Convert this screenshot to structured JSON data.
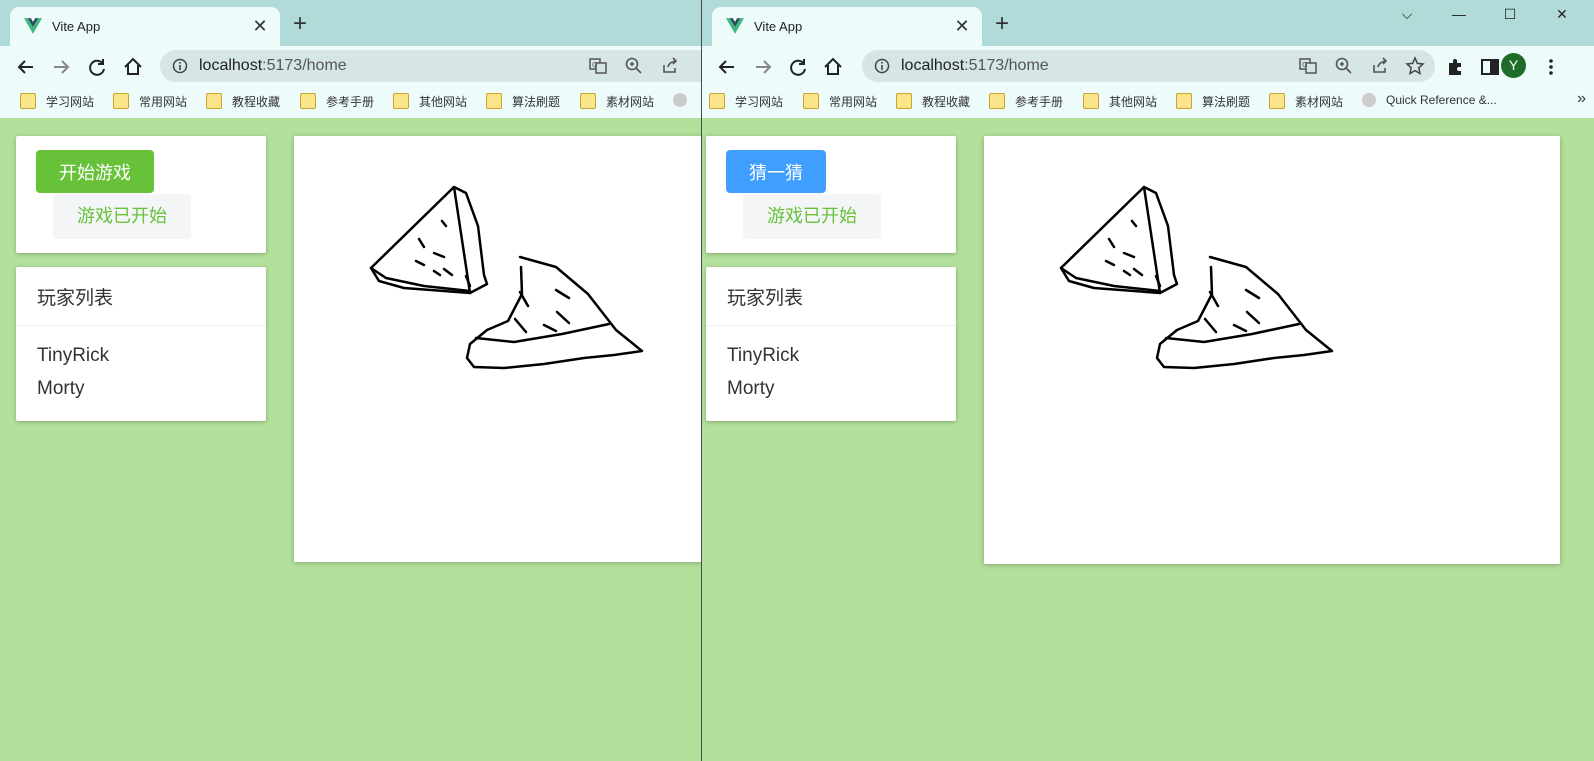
{
  "windows": [
    {
      "tab": {
        "title": "Vite App",
        "favicon": "vue-logo-icon"
      },
      "address": {
        "host": "localhost",
        "path": ":5173/home"
      },
      "bookmarks": [
        "学习网站",
        "常用网站",
        "教程收藏",
        "参考手册",
        "其他网站",
        "算法刷题",
        "素材网站"
      ],
      "game": {
        "action_button": "开始游戏",
        "action_color": "#67c23a",
        "status": "游戏已开始",
        "players_title": "玩家列表",
        "players": [
          "TinyRick",
          "Morty"
        ]
      }
    },
    {
      "tab": {
        "title": "Vite App",
        "favicon": "vue-logo-icon"
      },
      "address": {
        "host": "localhost",
        "path": ":5173/home"
      },
      "bookmarks": [
        "学习网站",
        "常用网站",
        "教程收藏",
        "参考手册",
        "其他网站",
        "算法刷题",
        "素材网站",
        "Quick Reference &..."
      ],
      "profile_initial": "Y",
      "game": {
        "action_button": "猜一猜",
        "action_color": "#409eff",
        "status": "游戏已开始",
        "players_title": "玩家列表",
        "players": [
          "TinyRick",
          "Morty"
        ]
      }
    }
  ],
  "colors": {
    "page_background": "#b3e09b",
    "tab_strip": "#b1dbd8",
    "toolbar": "#eefbfb",
    "status_text": "#67c23a"
  },
  "drawing": {
    "description": "sketch"
  }
}
